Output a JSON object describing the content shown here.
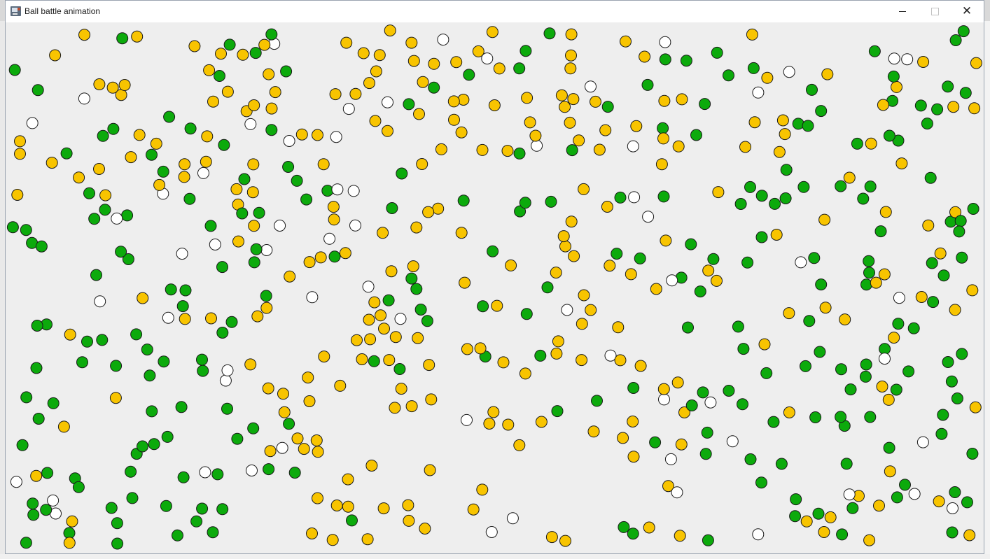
{
  "window": {
    "title": "Ball battle animation",
    "buttons": {
      "minimize": "─",
      "maximize": "",
      "close": "✕"
    },
    "icon": "java-cup-icon"
  },
  "legend_colors": {
    "yellow_team": "#f8c400",
    "green_team": "#0caa0c",
    "neutral": "#ffffff",
    "outline": "#1a1a1a"
  },
  "ball_counts_estimate": {
    "yellow": 250,
    "green": 250,
    "white": 60
  }
}
